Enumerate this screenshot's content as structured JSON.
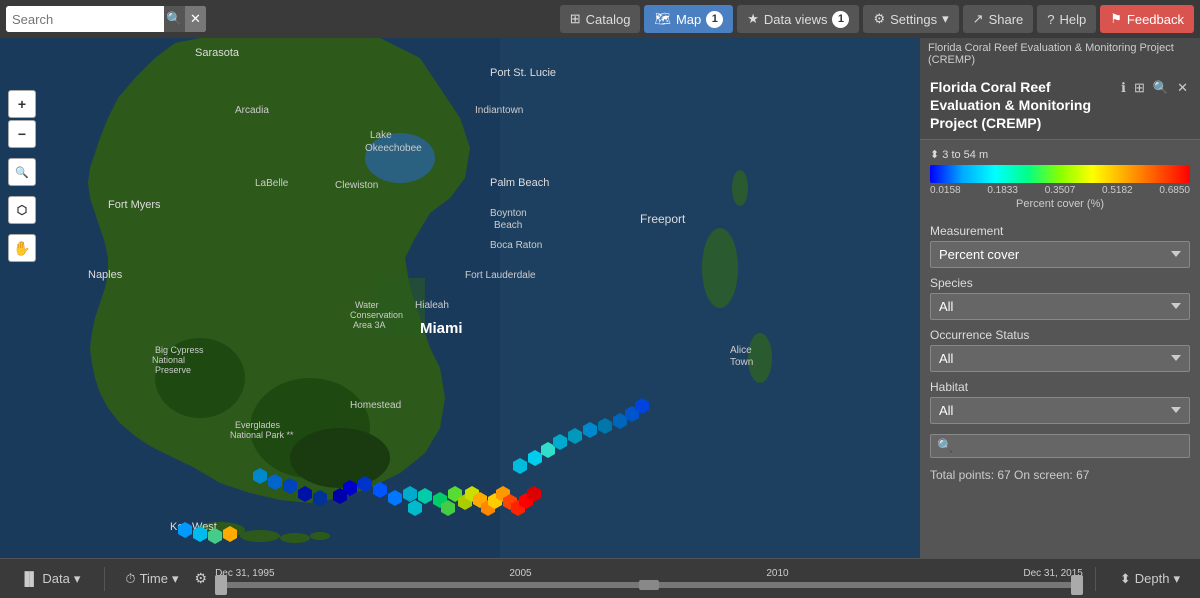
{
  "topnav": {
    "search_placeholder": "Search",
    "catalog_label": "Catalog",
    "map_label": "Map",
    "map_badge": "1",
    "dataviews_label": "Data views",
    "dataviews_badge": "1",
    "settings_label": "Settings",
    "share_label": "Share",
    "help_label": "Help",
    "feedback_label": "Feedback"
  },
  "bottombar": {
    "data_label": "Data",
    "time_label": "Time",
    "depth_label": "Depth",
    "date_start": "Dec 31, 1995",
    "date_mid": "2005",
    "date_mid2": "2010",
    "date_end": "Dec 31, 2015"
  },
  "panel": {
    "header_small": "Florida Coral Reef Evaluation & Monitoring Project (CREMP)",
    "title": "Florida Coral Reef Evaluation & Monitoring Project (CREMP)",
    "depth_range": "3 to 54 m",
    "colorbar_values": [
      "0.0158",
      "0.1833",
      "0.3507",
      "0.5182",
      "0.6850"
    ],
    "pct_label": "Percent cover (%)",
    "measurement_label": "Measurement",
    "measurement_value": "Percent cover",
    "species_label": "Species",
    "species_value": "All",
    "occurrence_label": "Occurrence Status",
    "occurrence_value": "All",
    "habitat_label": "Habitat",
    "habitat_value": "All",
    "total_points": "Total points: 67 On screen: 67",
    "search_placeholder": ""
  },
  "map_controls": {
    "zoom_in": "+",
    "zoom_out": "−",
    "zoom_extent": "⊕",
    "draw": "⬡",
    "pan": "✋"
  },
  "map_labels": {
    "sarasota": "Sarasota",
    "arcadia": "Arcadia",
    "port_st_lucie": "Port St. Lucie",
    "indiantown": "Indiantown",
    "okeechobee": "Lake\nOkeechobee",
    "labelle": "LaBelle",
    "clewiston": "Clewiston",
    "palm_beach": "Palm Beach",
    "fort_myers": "Fort Myers",
    "boynton_beach": "Boynton\nBeach",
    "naples": "Naples",
    "boca_raton": "Boca Raton",
    "fort_lauderdale": "Fort Lauderdale",
    "hialeah": "Hialeah",
    "miami": "Miami",
    "key_west": "Key West",
    "homestead": "Homestead",
    "freeport": "Freeport",
    "water_conservation": "Water\nConservation\nArea 3A",
    "big_cypress": "Big Cypress\nNational\nPreserve",
    "everglades": "Everglades\nNational Park **",
    "alice_town": "Alice\nTown"
  }
}
